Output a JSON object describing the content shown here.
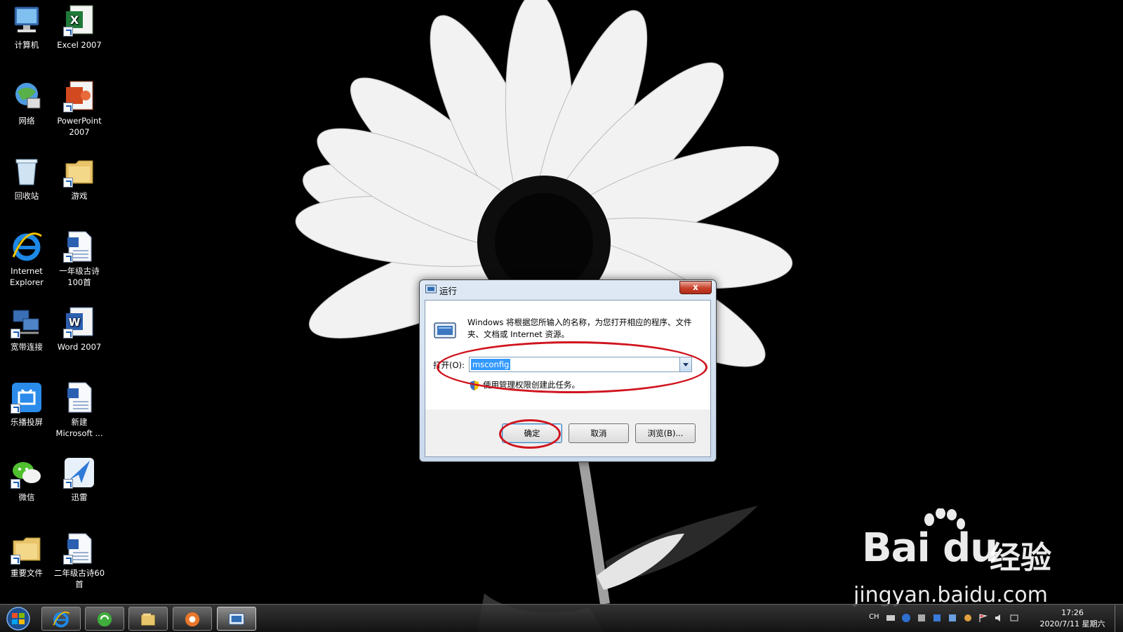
{
  "desktop": {
    "icons": [
      {
        "label": "计算机",
        "icon": "computer-icon"
      },
      {
        "label": "Excel 2007",
        "icon": "excel-icon"
      },
      {
        "label": "网络",
        "icon": "network-icon"
      },
      {
        "label": "PowerPoint 2007",
        "icon": "powerpoint-icon"
      },
      {
        "label": "回收站",
        "icon": "recycle-bin-icon"
      },
      {
        "label": "游戏",
        "icon": "folder-icon"
      },
      {
        "label": "Internet Explorer",
        "icon": "ie-icon"
      },
      {
        "label": "一年级古诗100首",
        "icon": "word-doc-icon"
      },
      {
        "label": "宽带连接",
        "icon": "broadband-icon"
      },
      {
        "label": "Word 2007",
        "icon": "word-icon"
      },
      {
        "label": "乐播投屏",
        "icon": "lebo-icon"
      },
      {
        "label": "新建 Microsoft ...",
        "icon": "word-doc-icon"
      },
      {
        "label": "微信",
        "icon": "wechat-icon"
      },
      {
        "label": "迅雷",
        "icon": "xunlei-icon"
      },
      {
        "label": "重要文件",
        "icon": "folder-icon"
      },
      {
        "label": "二年级古诗60首",
        "icon": "word-doc-icon"
      }
    ]
  },
  "run_dialog": {
    "title": "运行",
    "close_label": "x",
    "description": "Windows 将根据您所输入的名称，为您打开相应的程序、文件夹、文档或 Internet 资源。",
    "open_label": "打开(O):",
    "open_value": "msconfig",
    "admin_note": "使用管理权限创建此任务。",
    "ok_label": "确定",
    "cancel_label": "取消",
    "browse_label": "浏览(B)..."
  },
  "watermark": {
    "logo": "Bai  du",
    "brand_cn": "经验",
    "url": "jingyan.baidu.com"
  },
  "taskbar": {
    "buttons": [
      "ie-icon",
      "green-browser-icon",
      "explorer-icon",
      "media-icon",
      "run-icon"
    ],
    "tray": {
      "lang": "CH",
      "time": "17:26",
      "date": "2020/7/11 星期六"
    }
  },
  "colors": {
    "annotation": "#d0141e",
    "selection": "#3399ff"
  }
}
